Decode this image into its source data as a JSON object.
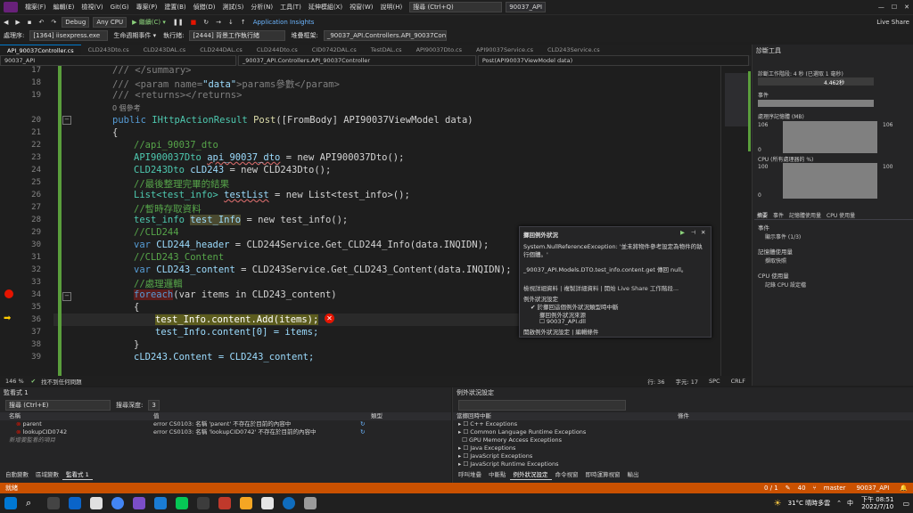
{
  "menu": {
    "items": [
      "檔案(F)",
      "編輯(E)",
      "檢視(V)",
      "Git(G)",
      "專案(P)",
      "建置(B)",
      "偵錯(D)",
      "測試(S)",
      "分析(N)",
      "工具(T)",
      "延伸模組(X)",
      "視窗(W)",
      "說明(H)"
    ],
    "search": "搜尋 (Ctrl+Q)",
    "project": "90037_API"
  },
  "toolbar": {
    "config": "Debug",
    "platform": "Any CPU",
    "continue": "▶ 繼續(C) ▾",
    "app_insights": "Application Insights",
    "live_share": "Live Share"
  },
  "toolbar2": {
    "process_label": "處理序:",
    "process": "[1364] iisexpress.exe",
    "lifecycle": "生命週期事件 ▾",
    "thread_label": "執行緒:",
    "thread": "[2444] 背景工作執行緒",
    "stack_label": "堆疊框架:",
    "stack": "_90037_API.Controllers.API_90037Contr"
  },
  "tabs": [
    "API_90037Controller.cs",
    "CLD243Dto.cs",
    "CLD243DAL.cs",
    "CLD244DAL.cs",
    "CLD244Dto.cs",
    "CID0742DAL.cs",
    "TestDAL.cs",
    "API90037Dto.cs",
    "API90037Service.cs",
    "CLD243Service.cs"
  ],
  "navbar": {
    "project": "90037_API",
    "class": "_90037_API.Controllers.API_90037Controller",
    "member": "Post(API90037ViewModel data)"
  },
  "code": {
    "line_numbers": [
      "17",
      "18",
      "19",
      "",
      "20",
      "21",
      "22",
      "23",
      "24",
      "25",
      "26",
      "27",
      "28",
      "29",
      "30",
      "31",
      "32",
      "33",
      "34",
      "35",
      "36",
      "37",
      "38",
      "39"
    ],
    "ref_count": "0 個參考",
    "lines": {
      "l17": "/// </summary>",
      "l18_a": "/// ",
      "l18_b": "<param name=",
      "l18_c": "\"data\"",
      "l18_d": ">params參數",
      "l18_e": "</param>",
      "l19": "/// <returns></returns>",
      "l20_kw": "public",
      "l20_ty": "IHttpActionResult",
      "l20_fn": "Post",
      "l20_rest": "([FromBody] API90037ViewModel data)",
      "l21": "{",
      "l22": "//api_90037_dto",
      "l23_ty": "API900037Dto",
      "l23_var": "api_90037_dto",
      "l23_rest": " = new API900037Dto();",
      "l24_ty": "CLD243Dto",
      "l24_var": "cLD243",
      "l24_rest": " = new CLD243Dto();",
      "l25": "//最後整理完畢的結果",
      "l26_ty": "List<test_info>",
      "l26_var": "testList",
      "l26_rest": " = new List<test_info>();",
      "l27": "//暫時存取資料",
      "l28_ty": "test_info",
      "l28_var": "test_Info",
      "l28_rest": " = new test_info();",
      "l29": "//CLD244",
      "l30_kw": "var",
      "l30_var": "CLD244_header",
      "l30_rest": " = CLD244Service.Get_CLD244_Info(data.INQIDN);",
      "l31": "//CLD243_Content",
      "l32_kw": "var",
      "l32_var": "CLD243_content",
      "l32_rest": " = CLD243Service.Get_CLD243_Content(data.INQIDN);",
      "l33": "//處理邏輯",
      "l34_kw": "foreach",
      "l34_rest": "(var items in CLD243_content)",
      "l35": "{",
      "l36": "test_Info.content.Add(items);",
      "l37": "test_Info.content[0] = items;",
      "l38": "}",
      "l39": "cLD243.Content = CLD243_content;"
    }
  },
  "editor_status": {
    "zoom": "146 %",
    "issues": "找不到任何問題",
    "line": "行: 36",
    "char": "字元: 17",
    "spc": "SPC",
    "crlf": "CRLF"
  },
  "diag": {
    "title": "診斷工具",
    "session": "診斷工作階段: 4 秒 (已選取 1 毫秒)",
    "timer": "4.462秒",
    "events": "事件",
    "memory": "處理序記憶體 (MB)",
    "mem_max": "106",
    "mem_min": "0",
    "cpu": "CPU (所有處理器的 %)",
    "cpu_max": "100",
    "cpu_min": "0",
    "tabs": [
      "摘要",
      "事件",
      "記憶體使用量",
      "CPU 使用量"
    ],
    "ev_label": "事件",
    "ev_item": "顯示事件 (1/3)",
    "mem_label": "記憶體使用量",
    "mem_item": "擷取快照",
    "cpu_label": "CPU 使用量",
    "cpu_item": "記錄 CPU 設定檔"
  },
  "exception": {
    "title": "擲回例外狀況",
    "type": "System.NullReferenceException: '並未將物件參考設定為物件的執行個體。'",
    "detail": "_90037_API.Models.DTO.test_info.content.get 傳回 null。",
    "links": "檢視詳細資料 | 複製詳細資料 | 開始 Live Share 工作階段...",
    "settings": "例外狀況設定",
    "opt1": "於擲回這個例外狀況類型時中斷",
    "opt2": "擲回例外狀況來源",
    "opt3": "90037_API.dll",
    "footer": "開啟例外狀況設定 | 編輯條件"
  },
  "watch": {
    "title": "監看式 1",
    "search": "搜尋 (Ctrl+E)",
    "depth_label": "搜尋深度:",
    "depth": "3",
    "cols": [
      "名稱",
      "值",
      "類型"
    ],
    "rows": [
      {
        "name": "parent",
        "value": "error CS0103: 名稱 'parent' 不存在於目前的內容中"
      },
      {
        "name": "lookupCID0742",
        "value": "error CS0103: 名稱 'lookupCID0742' 不存在於目前的內容中"
      }
    ],
    "add": "新增要監看的項目",
    "tabs": [
      "自動變數",
      "區域變數",
      "監看式 1"
    ]
  },
  "exset": {
    "title": "例外狀況設定",
    "col1": "當擲回時中斷",
    "col2": "條件",
    "items": [
      "C++ Exceptions",
      "Common Language Runtime Exceptions",
      "GPU Memory Access Exceptions",
      "Java Exceptions",
      "JavaScript Exceptions",
      "JavaScript Runtime Exceptions"
    ],
    "tabs": [
      "呼叫堆疊",
      "中斷點",
      "例外狀況設定",
      "命令視窗",
      "即時運算視窗",
      "輸出"
    ]
  },
  "statusbar": {
    "state": "就緒",
    "errors": "0 / 1",
    "up": "40",
    "branch": "master",
    "repo": "90037_API"
  },
  "taskbar": {
    "weather": "31°C 晴時多雲",
    "lang": "中",
    "time": "下午 08:51",
    "date": "2022/7/10"
  },
  "colors": {
    "accent": "#007acc",
    "status": "#ca5100",
    "breakpoint": "#e51400"
  }
}
